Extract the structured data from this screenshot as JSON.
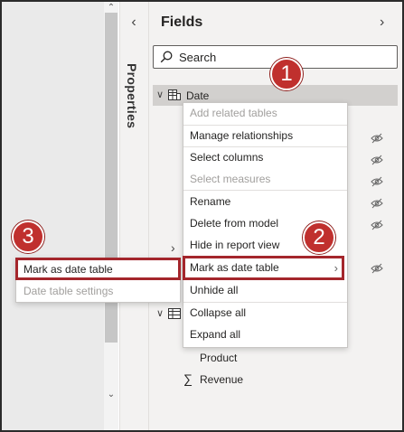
{
  "properties_pane": {
    "label": "Properties",
    "collapse_icon": "chevron-left-icon"
  },
  "fields_pane": {
    "title": "Fields",
    "expand_icon": "chevron-right-icon",
    "search": {
      "placeholder": "Search",
      "icon": "search-icon"
    },
    "tree": {
      "date_table": "Date",
      "product_label": "Product",
      "revenue_label": "Revenue",
      "revenue_icon": "sigma-icon"
    }
  },
  "context_menu": {
    "items": [
      {
        "label": "Add related tables",
        "disabled": true
      },
      {
        "label": "Manage relationships",
        "disabled": false
      },
      {
        "label": "Select columns",
        "disabled": false
      },
      {
        "label": "Select measures",
        "disabled": true
      },
      {
        "label": "Rename",
        "disabled": false
      },
      {
        "label": "Delete from model",
        "disabled": false
      },
      {
        "label": "Hide in report view",
        "disabled": false
      },
      {
        "label": "Mark as date table",
        "disabled": false,
        "has_submenu": true
      },
      {
        "label": "Unhide all",
        "disabled": false
      },
      {
        "label": "Collapse all",
        "disabled": false
      },
      {
        "label": "Expand all",
        "disabled": false
      }
    ]
  },
  "submenu": {
    "items": [
      {
        "label": "Mark as date table",
        "disabled": false
      },
      {
        "label": "Date table settings",
        "disabled": true
      }
    ]
  },
  "callouts": [
    "1",
    "2",
    "3"
  ],
  "colors": {
    "callout_fill": "#c0302e",
    "highlight_border": "#a4262c",
    "selected_row": "#d2d0ce",
    "pane_bg": "#f3f2f1"
  }
}
